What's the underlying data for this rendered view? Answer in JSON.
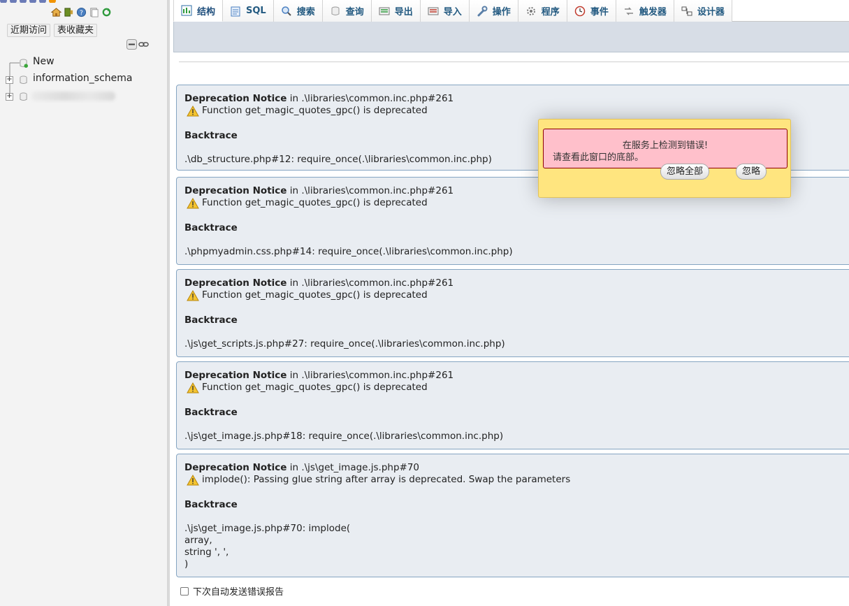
{
  "navigation": {
    "quick_links": [
      "近期访问",
      "表收藏夹"
    ],
    "tree": {
      "new_label": "New",
      "databases": [
        "information_schema"
      ]
    }
  },
  "top_menu": {
    "tabs": [
      {
        "label": "结构",
        "icon": "structure-icon",
        "active": true
      },
      {
        "label": "SQL",
        "icon": "sql-icon",
        "active": false
      },
      {
        "label": "搜索",
        "icon": "search-icon",
        "active": false
      },
      {
        "label": "查询",
        "icon": "query-icon",
        "active": false
      },
      {
        "label": "导出",
        "icon": "export-icon",
        "active": false
      },
      {
        "label": "导入",
        "icon": "import-icon",
        "active": false
      },
      {
        "label": "操作",
        "icon": "wrench-icon",
        "active": false
      },
      {
        "label": "程序",
        "icon": "routines-icon",
        "active": false
      },
      {
        "label": "事件",
        "icon": "clock-icon",
        "active": false
      },
      {
        "label": "触发器",
        "icon": "triggers-icon",
        "active": false
      },
      {
        "label": "设计器",
        "icon": "designer-icon",
        "active": false
      }
    ]
  },
  "notices": [
    {
      "title": "Deprecation Notice",
      "location": " in .\\libraries\\common.inc.php#261",
      "message": "Function get_magic_quotes_gpc() is deprecated",
      "backtrace_label": "Backtrace",
      "trace": [
        ".\\db_structure.php#12: require_once(.\\libraries\\common.inc.php)"
      ]
    },
    {
      "title": "Deprecation Notice",
      "location": " in .\\libraries\\common.inc.php#261",
      "message": "Function get_magic_quotes_gpc() is deprecated",
      "backtrace_label": "Backtrace",
      "trace": [
        ".\\phpmyadmin.css.php#14: require_once(.\\libraries\\common.inc.php)"
      ]
    },
    {
      "title": "Deprecation Notice",
      "location": " in .\\libraries\\common.inc.php#261",
      "message": "Function get_magic_quotes_gpc() is deprecated",
      "backtrace_label": "Backtrace",
      "trace": [
        ".\\js\\get_scripts.js.php#27: require_once(.\\libraries\\common.inc.php)"
      ]
    },
    {
      "title": "Deprecation Notice",
      "location": " in .\\libraries\\common.inc.php#261",
      "message": "Function get_magic_quotes_gpc() is deprecated",
      "backtrace_label": "Backtrace",
      "trace": [
        ".\\js\\get_image.js.php#18: require_once(.\\libraries\\common.inc.php)"
      ]
    },
    {
      "title": "Deprecation Notice",
      "location": " in .\\js\\get_image.js.php#70",
      "message": "implode(): Passing glue string after array is deprecated. Swap the parameters",
      "backtrace_label": "Backtrace",
      "trace": [
        ".\\js\\get_image.js.php#70: implode(",
        "array,",
        "string ', ',",
        ")"
      ]
    }
  ],
  "error_popup": {
    "title": "在服务上检测到错误!",
    "subtitle": "请查看此窗口的底部。",
    "ignore_all_label": "忽略全部",
    "ignore_label": "忽略"
  },
  "footer": {
    "auto_report_label": "下次自动发送错误报告",
    "auto_report_checked": false
  },
  "colors": {
    "tab_text": "#235a81",
    "notice_bg": "#e9edf2",
    "notice_border": "#85a5c2",
    "popup_bg": "#ffe57f",
    "popup_message_bg": "#ffc0cb"
  }
}
